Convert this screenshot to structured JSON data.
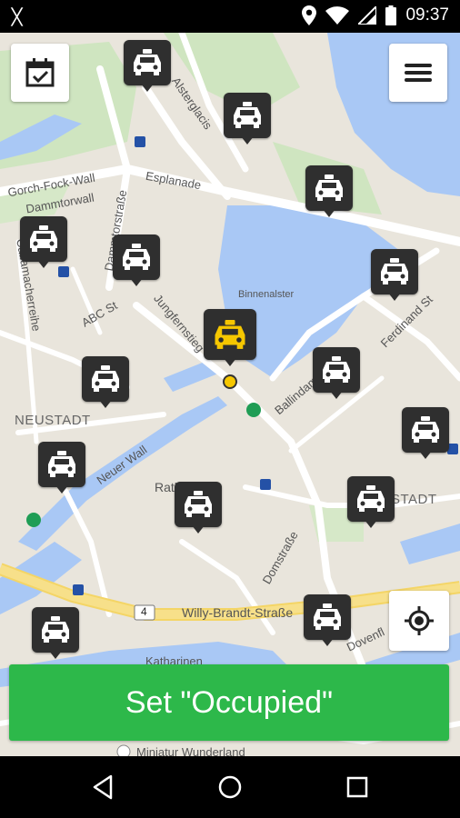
{
  "status_bar": {
    "time": "09:37",
    "left_icon": "ᚷ",
    "icons": [
      "location-icon",
      "wifi-icon",
      "cellular-icon",
      "battery-icon"
    ]
  },
  "map": {
    "labels": {
      "gorch_fock_wall": "Gorch-Fock-Wall",
      "dammtorwall": "Dammtorwall",
      "esplanade": "Esplanade",
      "dammtorstrasse": "Dammtorstraße",
      "alsterglacis": "Alsterglacis",
      "binnenalster": "Binnenalster",
      "jungfernstieg": "Jungfernstieg",
      "abc_st": "ABC St",
      "caffamacherreihe": "Caffamacherreihe",
      "neustadt": "NEUSTADT",
      "neuer_wall": "Neuer Wall",
      "ballindamm": "Ballindamm",
      "ferdinand_st": "Ferdinand St",
      "rathaus": "Rathaus",
      "stadt": "STADT",
      "domstrasse": "Domstraße",
      "willy_brandt": "Willy-Brandt-Straße",
      "route_4": "4",
      "katharinen": "Katharinen",
      "dovenfleet": "Dovenfl",
      "miniatur": "Miniatur Wunderland"
    }
  },
  "top_left_button": {
    "icon": "calendar-check-icon"
  },
  "top_right_button": {
    "icon": "menu-icon"
  },
  "locate_button": {
    "icon": "crosshair-icon"
  },
  "taxi_icon": "taxi-icon",
  "active_color": "#f6c700",
  "marker_color": "#2f2f2f",
  "primary_action": {
    "label": "Set \"Occupied\"",
    "color": "#2db84a"
  },
  "nav_bar": {
    "icons": [
      "back-icon",
      "home-icon",
      "recents-icon"
    ]
  }
}
